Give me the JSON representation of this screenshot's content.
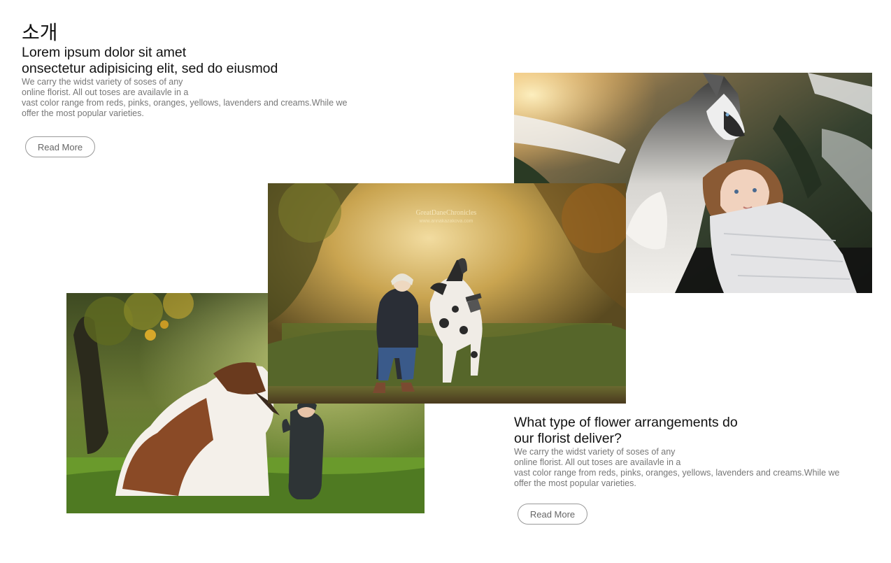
{
  "intro": {
    "heading": "소개",
    "subheading_line1": "Lorem ipsum dolor sit amet",
    "subheading_line2": "onsectetur adipisicing elit, sed do eiusmod",
    "body_line1": "We carry the widst variety of soses of any",
    "body_line2": "online florist. All out toses are availavle in a",
    "body_line3": "vast color range from reds, pinks, oranges, yellows, lavenders and creams.While we",
    "body_line4": "offer the most popular varieties.",
    "button_label": "Read More"
  },
  "second": {
    "heading_line1": "What type of flower arrangements do",
    "heading_line2": "our florist deliver?",
    "body_line1": "We carry the widst variety of soses of any",
    "body_line2": "online florist. All out toses are availavle in a",
    "body_line3": "vast color range from reds, pinks, oranges, yellows, lavenders and creams.While we",
    "body_line4": "offer the most popular varieties.",
    "button_label": "Read More"
  },
  "photos": {
    "watermark_line1": "GreatDaneChronicles",
    "watermark_line2": "www.annakazakova.com"
  },
  "colors": {
    "text": "#111111",
    "body_text": "#777777",
    "button_border": "#999999"
  }
}
